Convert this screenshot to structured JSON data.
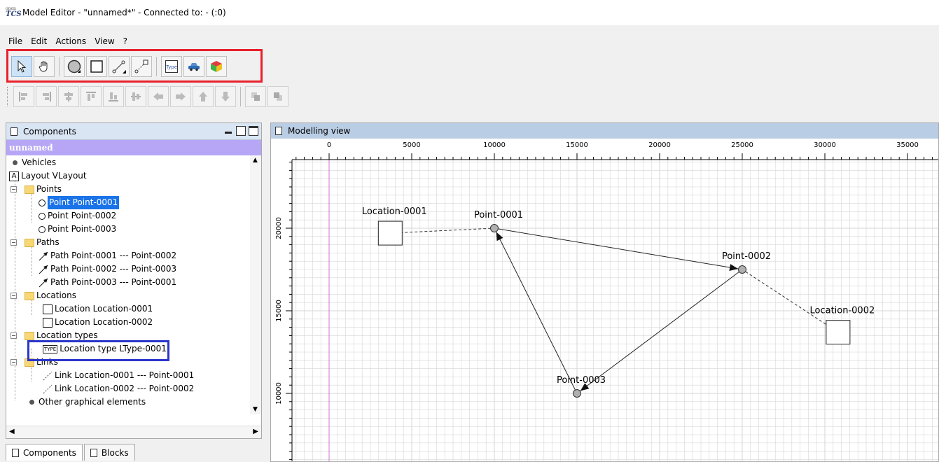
{
  "window": {
    "logo_top": "open",
    "logo_bottom": "TCS",
    "title": "Model Editor - \"unnamed*\" - Connected to: - (:0)"
  },
  "menu": [
    "File",
    "Edit",
    "Actions",
    "View",
    "?"
  ],
  "toolbar_primary": {
    "buttons": [
      "select-tool",
      "drag-tool",
      "create-point",
      "create-location",
      "create-path",
      "create-link",
      "create-location-type",
      "create-vehicle",
      "create-block"
    ],
    "selected": "select-tool",
    "type_label": "Type"
  },
  "toolbar_align": {
    "buttons": [
      "align-left",
      "align-right",
      "align-center-vertical",
      "align-top",
      "align-bottom",
      "align-center-horizontal",
      "move-left",
      "move-right",
      "move-up",
      "move-down",
      "bring-to-front",
      "send-to-back"
    ]
  },
  "components_panel": {
    "title": "Components",
    "model_name": "unnamed",
    "tree": {
      "vehicles": "Vehicles",
      "layout": "Layout VLayout",
      "points": "Points",
      "point_items": [
        "Point Point-0001",
        "Point Point-0002",
        "Point Point-0003"
      ],
      "paths": "Paths",
      "path_items": [
        "Path Point-0001 --- Point-0002",
        "Path Point-0002 --- Point-0003",
        "Path Point-0003 --- Point-0001"
      ],
      "locations": "Locations",
      "location_items": [
        "Location Location-0001",
        "Location Location-0002"
      ],
      "location_types": "Location types",
      "location_type_items": [
        "Location type LType-0001"
      ],
      "location_type_icon": "TYPE",
      "links": "Links",
      "link_items": [
        "Link Location-0001 --- Point-0001",
        "Link Location-0002 --- Point-0002"
      ],
      "other": "Other graphical elements"
    },
    "selected_item": "Point Point-0001"
  },
  "bottom_tabs": [
    "Components",
    "Blocks"
  ],
  "modelling_view": {
    "title": "Modelling view",
    "x_ticks": [
      "0",
      "5000",
      "10000",
      "15000",
      "20000",
      "25000",
      "30000",
      "35000"
    ],
    "y_ticks": [
      "20000",
      "15000",
      "10000"
    ],
    "points": [
      {
        "label": "Point-0001",
        "x": 10000,
        "y": 20000
      },
      {
        "label": "Point-0002",
        "x": 25000,
        "y": 17500
      },
      {
        "label": "Point-0003",
        "x": 15000,
        "y": 10000
      }
    ],
    "locations": [
      {
        "label": "Location-0001",
        "x": 3700,
        "y": 19700,
        "linked_to": "Point-0001"
      },
      {
        "label": "Location-0002",
        "x": 30800,
        "y": 13700,
        "linked_to": "Point-0002"
      }
    ],
    "paths": [
      {
        "from": "Point-0001",
        "to": "Point-0002"
      },
      {
        "from": "Point-0002",
        "to": "Point-0003"
      },
      {
        "from": "Point-0003",
        "to": "Point-0001"
      }
    ],
    "colors": {
      "grid": "#d6d6d6",
      "origin_line": "#d070d0",
      "node_fill": "#b0b0b0"
    }
  },
  "highlights": {
    "toolbar_box_color": "#e8202a",
    "location_type_box_color": "#2a35c9"
  }
}
